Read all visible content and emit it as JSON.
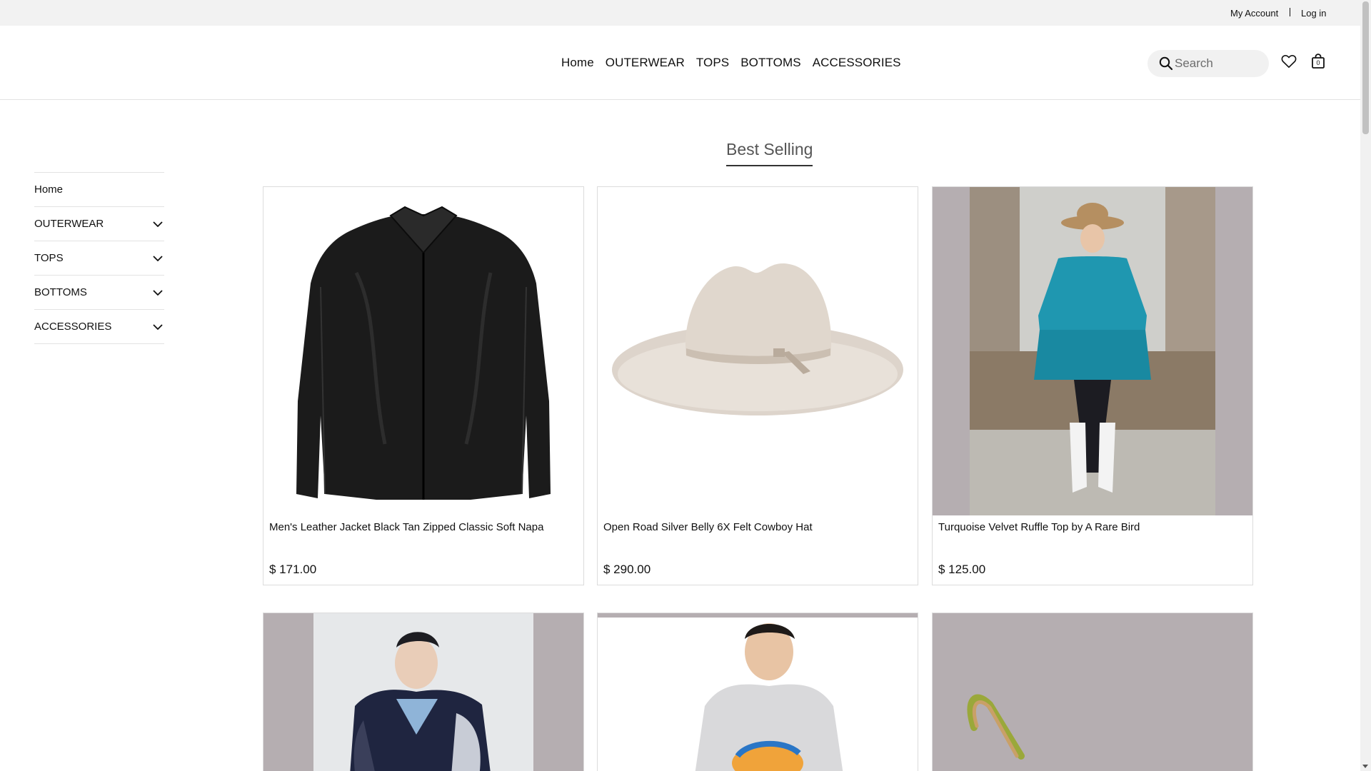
{
  "topbar": {
    "my_account": "My Account",
    "log_in": "Log in"
  },
  "nav": {
    "items": [
      "Home",
      "OUTERWEAR",
      "TOPS",
      "BOTTOMS",
      "ACCESSORIES"
    ]
  },
  "search": {
    "placeholder": "Search"
  },
  "cart": {
    "count": "0"
  },
  "sidebar": {
    "items": [
      {
        "label": "Home",
        "expandable": false
      },
      {
        "label": "OUTERWEAR",
        "expandable": true
      },
      {
        "label": "TOPS",
        "expandable": true
      },
      {
        "label": "BOTTOMS",
        "expandable": true
      },
      {
        "label": "ACCESSORIES",
        "expandable": true
      }
    ]
  },
  "section": {
    "title": "Best Selling"
  },
  "products": [
    {
      "name": "Men's Leather Jacket Black Tan Zipped Classic Soft Napa",
      "price": "$ 171.00",
      "image": "black-leather-jacket"
    },
    {
      "name": "Open Road Silver Belly 6X Felt Cowboy Hat",
      "price": "$ 290.00",
      "image": "cream-cowboy-hat"
    },
    {
      "name": "Turquoise Velvet Ruffle Top by A Rare Bird",
      "price": "$ 125.00",
      "image": "woman-turquoise-top"
    },
    {
      "name": "",
      "price": "",
      "image": "man-navy-puffer-jacket"
    },
    {
      "name": "",
      "price": "",
      "image": "man-grey-hoodie"
    },
    {
      "name": "",
      "price": "",
      "image": "leather-strap"
    }
  ],
  "colors": {
    "topbar_bg": "#f2f2f2",
    "image_bg": "#b5aeb1",
    "text": "#111111"
  }
}
